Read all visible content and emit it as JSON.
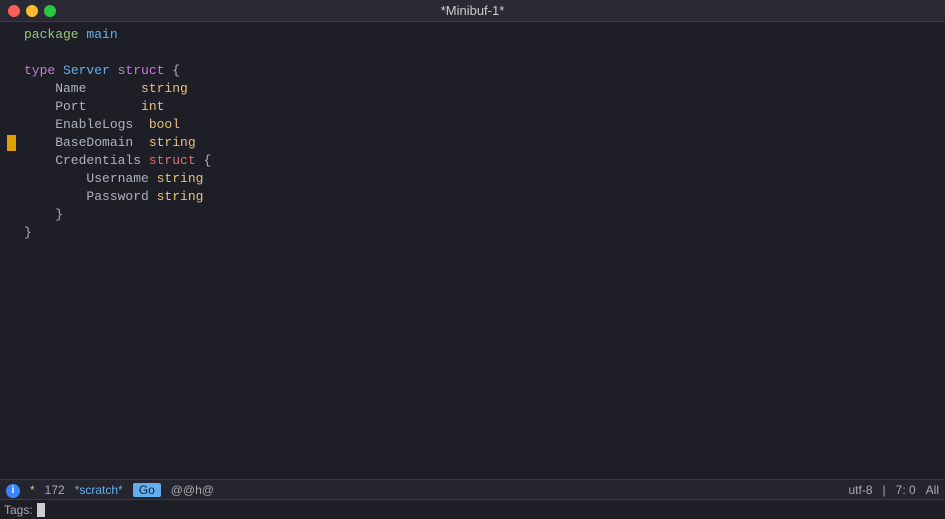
{
  "titlebar": {
    "title": "*Minibuf-1*",
    "controls": {
      "close_color": "#ff5f57",
      "minimize_color": "#febc2e",
      "maximize_color": "#28c840"
    }
  },
  "editor": {
    "lines": [
      {
        "number": "",
        "content": "package main",
        "parts": [
          {
            "text": "package ",
            "class": "kw-green"
          },
          {
            "text": "main",
            "class": "pkg-name"
          }
        ]
      },
      {
        "number": "",
        "content": "",
        "parts": []
      },
      {
        "number": "",
        "content": "type Server struct {",
        "parts": [
          {
            "text": "type ",
            "class": "kw-purple"
          },
          {
            "text": "Server ",
            "class": "kw-blue"
          },
          {
            "text": "struct ",
            "class": "kw-purple"
          },
          {
            "text": "{",
            "class": "brace"
          }
        ]
      },
      {
        "number": "",
        "content": "    Name       string",
        "parts": [
          {
            "text": "    Name       ",
            "class": "field-name"
          },
          {
            "text": "string",
            "class": "kw-type"
          }
        ]
      },
      {
        "number": "",
        "content": "    Port       int",
        "parts": [
          {
            "text": "    Port       ",
            "class": "field-name"
          },
          {
            "text": "int",
            "class": "kw-type"
          }
        ]
      },
      {
        "number": "",
        "content": "    EnableLogs  bool",
        "parts": [
          {
            "text": "    EnableLogs  ",
            "class": "field-name"
          },
          {
            "text": "bool",
            "class": "kw-type"
          }
        ]
      },
      {
        "number": "",
        "content": "    BaseDomain  string",
        "parts": [
          {
            "text": "    BaseDomain  ",
            "class": "field-name"
          },
          {
            "text": "string",
            "class": "kw-type"
          }
        ],
        "cursor": true
      },
      {
        "number": "",
        "content": "    Credentials struct {",
        "parts": [
          {
            "text": "    Credentials ",
            "class": "field-name"
          },
          {
            "text": "struct ",
            "class": "kw-red"
          },
          {
            "text": "{",
            "class": "brace"
          }
        ]
      },
      {
        "number": "",
        "content": "        Username string",
        "parts": [
          {
            "text": "        Username ",
            "class": "field-name"
          },
          {
            "text": "string",
            "class": "kw-type"
          }
        ]
      },
      {
        "number": "",
        "content": "        Password string",
        "parts": [
          {
            "text": "        Password ",
            "class": "field-name"
          },
          {
            "text": "string",
            "class": "kw-type"
          }
        ]
      },
      {
        "number": "",
        "content": "    }",
        "parts": [
          {
            "text": "    }",
            "class": "brace"
          }
        ]
      },
      {
        "number": "",
        "content": "}",
        "parts": [
          {
            "text": "}",
            "class": "brace"
          }
        ]
      },
      {
        "number": "",
        "content": "",
        "parts": []
      },
      {
        "number": "",
        "content": "",
        "parts": []
      },
      {
        "number": "",
        "content": "",
        "parts": []
      },
      {
        "number": "",
        "content": "",
        "parts": []
      },
      {
        "number": "",
        "content": "",
        "parts": []
      },
      {
        "number": "",
        "content": "",
        "parts": []
      },
      {
        "number": "",
        "content": "",
        "parts": []
      },
      {
        "number": "",
        "content": "",
        "parts": []
      },
      {
        "number": "",
        "content": "",
        "parts": []
      },
      {
        "number": "",
        "content": "",
        "parts": []
      },
      {
        "number": "",
        "content": "",
        "parts": []
      },
      {
        "number": "",
        "content": "",
        "parts": []
      },
      {
        "number": "",
        "content": "",
        "parts": []
      }
    ]
  },
  "statusbar": {
    "info_icon": "ℹ",
    "modified": "*",
    "line_count": "172",
    "buffer_name": "*scratch*",
    "mode": "Go",
    "keybinding": "@@h@",
    "encoding": "utf-8",
    "position": "7: 0",
    "scroll": "All"
  },
  "tagsbar": {
    "label": "Tags:",
    "value": ""
  }
}
